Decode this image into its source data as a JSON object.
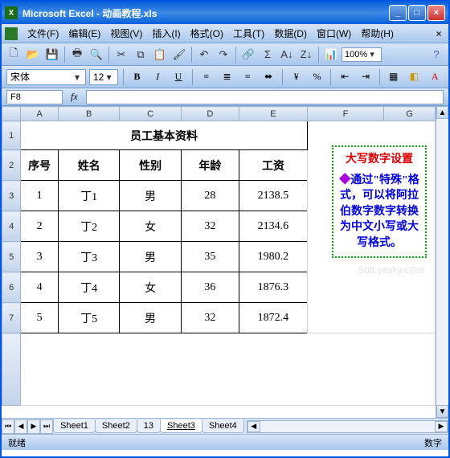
{
  "window": {
    "app": "Microsoft Excel",
    "doc": "动画教程.xls",
    "title_sep": " - "
  },
  "menus": [
    "文件(F)",
    "编辑(E)",
    "视图(V)",
    "插入(I)",
    "格式(O)",
    "工具(T)",
    "数据(D)",
    "窗口(W)",
    "帮助(H)"
  ],
  "zoom": "100%",
  "font": {
    "name": "宋体",
    "size": "12"
  },
  "name_box": "F8",
  "formula_bar": "",
  "columns": [
    "A",
    "B",
    "C",
    "D",
    "E",
    "F",
    "G"
  ],
  "rows": [
    "1",
    "2",
    "3",
    "4",
    "5",
    "6",
    "7"
  ],
  "chart_data": {
    "type": "table",
    "title": "员工基本资料",
    "headers": [
      "序号",
      "姓名",
      "性别",
      "年龄",
      "工资"
    ],
    "rows": [
      [
        "1",
        "丁1",
        "男",
        "28",
        "2138.5"
      ],
      [
        "2",
        "丁2",
        "女",
        "32",
        "2134.6"
      ],
      [
        "3",
        "丁3",
        "男",
        "35",
        "1980.2"
      ],
      [
        "4",
        "丁4",
        "女",
        "36",
        "1876.3"
      ],
      [
        "5",
        "丁5",
        "男",
        "32",
        "1872.4"
      ]
    ]
  },
  "callout": {
    "title": "大写数字设置",
    "body": "通过\"特殊\"格式，可以将阿拉伯数字数字转换为中文小写或大写格式。"
  },
  "watermark": "Soft.yesky.c⊙m",
  "sheet_tabs": [
    "Sheet1",
    "Sheet2",
    "13",
    "Sheet3",
    "Sheet4"
  ],
  "active_tab": 3,
  "status": {
    "left": "就绪",
    "right": "数字"
  }
}
